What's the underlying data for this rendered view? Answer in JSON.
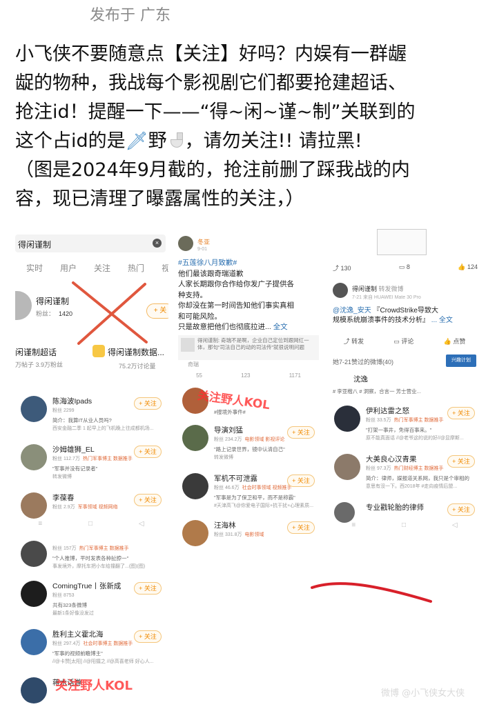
{
  "header": {
    "published": "发布于 广东"
  },
  "post": {
    "line1": "小飞侠不要随意点【关注】好吗？内娱有一群龌",
    "line2": "龊的物种，我战每个影视剧它们都要抢建超话、",
    "line3": "抢注id！提醒一下——“得~闲~谨~制”关联到的",
    "line4_pre": "这个占id的是",
    "line4_mid": "野",
    "line4_post": "，请勿关注!! 请拉黑!",
    "line5": "（图是2024年9月截的，抢注前删了踩我战的内",
    "line6": "容，现已清理了曝露属性的关注，）",
    "icons": [
      "sword-emoji",
      "toilet-emoji"
    ]
  },
  "shot_search": {
    "query": "得闲谨制",
    "tabs": [
      "实时",
      "用户",
      "关注",
      "热门",
      "视"
    ],
    "account": {
      "name": "得闲谨制",
      "fans_label": "粉丝：",
      "fans": "1420",
      "follow": "+ 关"
    },
    "topic": {
      "name": "闲谨制超话",
      "sub": "万帖子 3.9万粉丝"
    },
    "topic2": {
      "name": "得闲谨制数据...",
      "sub": "75.2万讨论量"
    },
    "colors": {
      "cross": "#e0573e",
      "follow": "#f08a00"
    }
  },
  "shot_post": {
    "author": "冬亚",
    "date": "9-01",
    "hashtag": "#五莲徐八月致歉#",
    "lines": [
      "他们最该跟奇瑞道歉",
      "人家长期跟你合作给你发广子提供各",
      "种支持。",
      "你却没在第一时间告知他们事实真相",
      "和可能风险。",
      "只是故意把他们也彻底拉进..."
    ],
    "more": "全文",
    "source": "得闲谨制: 奇瑞不是啊，企业自己定位到跟网红一体，那句“司法自己的动的司法传”就很说明问题",
    "source_tag": "奇瑞",
    "counts": [
      "55",
      "123",
      "1171"
    ]
  },
  "shot_repost": {
    "stats": [
      "130",
      "8",
      "124"
    ],
    "name": "得闲谨制",
    "name_suffix": "转发微博",
    "sub": "7-21 来自 HUAWEI Mate 30 Pro",
    "mention": "@沈逸_安天",
    "link_text": "『CrowdStrike导致大",
    "line2": "规模系统崩溃事件的技术分析』",
    "more": "... 全文",
    "actions": [
      "转发",
      "评论",
      "点赞"
    ],
    "liked_header": "她7-21赞过的微博(40)",
    "banner": "兴趣计划",
    "last_name": "沈逸"
  },
  "list_a": {
    "users": [
      {
        "name": "陈海波Ipads",
        "fans": "粉丝 2299",
        "tag": "",
        "desc": "简介：我算IT从业人员吗?",
        "extra": "西安金融二季 1 起早上的飞机晚上往成都机场...",
        "follow": "+ 关注"
      },
      {
        "name": "沙姆雄狮_EL",
        "fans": "粉丝 112.7万",
        "tag": "热门军事博主 数据推手",
        "desc": "\"军事并没有记录者\"",
        "extra": "转发微博",
        "follow": "+ 关注"
      },
      {
        "name": "李葆春",
        "fans": "粉丝 2.9万",
        "tag": "军事领域 视频网络",
        "desc": "",
        "extra": "",
        "follow": "+ 关注"
      }
    ],
    "nav": [
      "≡",
      "□",
      "◁"
    ]
  },
  "list_b": {
    "users": [
      {
        "name": "",
        "fans": "粉丝 157万",
        "tag": "热门军事博主 数据推手",
        "desc": "\"个人推博，平时发表各种扯脖一\"",
        "extra": "事发境外，摩托车把小车给撞翻了...(图)(图)",
        "follow": ""
      },
      {
        "name": "ComingTrue丨张新成",
        "fans": "粉丝 8753",
        "tag": "",
        "desc": "共有323条微博",
        "extra": "最新1条好像没发过",
        "follow": "+ 关注"
      },
      {
        "name": "胜利主义霍北海",
        "fans": "粉丝 297.4万",
        "tag": "社会时事博主 数据推手",
        "desc": "\"军事的视频前瞻博主\"",
        "extra": "//@卡赞[太阳] //@阳擂之 //@高喜老师 好心人...",
        "follow": "+ 关注"
      },
      {
        "name": "蒋木话游",
        "fans": "",
        "tag": "",
        "desc": "",
        "extra": "",
        "follow": ""
      }
    ]
  },
  "list_c": {
    "users": [
      {
        "name": "",
        "fans": "",
        "tag": "",
        "desc": "#搜境外事件#",
        "extra": "",
        "follow": ""
      },
      {
        "name": "导演刘猛",
        "fans": "粉丝 234.2万",
        "tag": "电影领域 影视评论",
        "desc": "\"路上记录世界，镜中认清自己\"",
        "extra": "转发微博",
        "follow": "+ 关注"
      },
      {
        "name": "军机不可泄露",
        "fans": "粉丝 46.6万",
        "tag": "社会时事领域 视频推手",
        "desc": "\"军事是为了保卫和平，而不是称霸\"",
        "extra": "#天津高飞@你爱电子国际+抗干扰+心理素质...",
        "follow": "+ 关注"
      },
      {
        "name": "汪海林",
        "fans": "粉丝 331.8万",
        "tag": "电影领域",
        "desc": "",
        "extra": "",
        "follow": "+ 关注"
      }
    ]
  },
  "list_d": {
    "header": "沈逸",
    "header_desc": "# 李亚楷八 # 洞察，合言一 芳士营业...",
    "users": [
      {
        "name": "伊利达雷之怒",
        "fans": "粉丝 33.5万",
        "tag": "热门军事博主 数据推手",
        "desc": "\"打架一事井，免得百事来。\"",
        "extra": "原不能真面话 //@老爷这的说的好//@显摩斯...",
        "follow": "+ 关注"
      },
      {
        "name": "大美良心汉青果",
        "fans": "粉丝 97.3万",
        "tag": "热门财经博主 数据推手",
        "desc": "简介：律师，媒报道关系网，我只是个审相的",
        "extra": "意思有沒一下。西2018年 #走向疫情后盟...",
        "follow": "+ 关注"
      },
      {
        "name": "专业戳轮胎的律师",
        "fans": "",
        "tag": "",
        "desc": "",
        "extra": "",
        "follow": "+ 关注"
      }
    ],
    "nav": [
      "≡",
      "□",
      "◁"
    ]
  },
  "stamps": {
    "top": "关注野人KOL",
    "bottom": "关注野人KOL"
  },
  "watermark": "微博 @小飞侠女大侠",
  "colors": {
    "stamp": "#ff3030",
    "stroke": "#d8202a"
  }
}
